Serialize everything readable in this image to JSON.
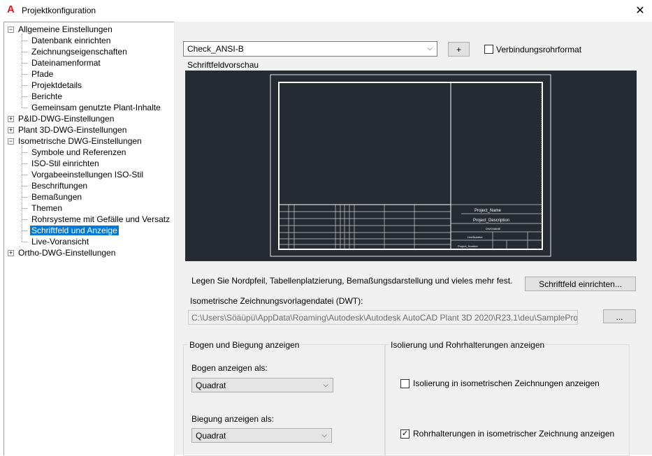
{
  "window": {
    "title": "Projektkonfiguration"
  },
  "tree": [
    {
      "label": "Allgemeine Einstellungen",
      "level": 0,
      "expander": "minus"
    },
    {
      "label": "Datenbank einrichten",
      "level": 1
    },
    {
      "label": "Zeichnungseigenschaften",
      "level": 1
    },
    {
      "label": "Dateinamenformat",
      "level": 1
    },
    {
      "label": "Pfade",
      "level": 1
    },
    {
      "label": "Projektdetails",
      "level": 1
    },
    {
      "label": "Berichte",
      "level": 1
    },
    {
      "label": "Gemeinsam genutzte Plant-Inhalte",
      "level": 1
    },
    {
      "label": "P&ID-DWG-Einstellungen",
      "level": 0,
      "expander": "plus"
    },
    {
      "label": "Plant 3D-DWG-Einstellungen",
      "level": 0,
      "expander": "plus"
    },
    {
      "label": "Isometrische DWG-Einstellungen",
      "level": 0,
      "expander": "minus"
    },
    {
      "label": "Symbole und Referenzen",
      "level": 1
    },
    {
      "label": "ISO-Stil einrichten",
      "level": 1
    },
    {
      "label": "Vorgabeeinstellungen ISO-Stil",
      "level": 1
    },
    {
      "label": "Beschriftungen",
      "level": 1
    },
    {
      "label": "Bemaßungen",
      "level": 1
    },
    {
      "label": "Themen",
      "level": 1
    },
    {
      "label": "Rohrsysteme mit Gefälle und Versatz",
      "level": 1
    },
    {
      "label": "Schriftfeld und Anzeige",
      "level": 1,
      "selected": true
    },
    {
      "label": "Live-Voransicht",
      "level": 1
    },
    {
      "label": "Ortho-DWG-Einstellungen",
      "level": 0,
      "expander": "plus"
    }
  ],
  "main": {
    "style_combo": "Check_ANSI-B",
    "add_button": "+",
    "verbindungsrohr_label": "Verbindungsrohrformat",
    "preview_title": "Schriftfeldvorschau",
    "preview_texts": {
      "project_name": "Project_Name",
      "project_description": "Project_Description",
      "dwgname": "DWGNAME",
      "project_number": "Project_Number",
      "linenumber": "LineNumber"
    },
    "description": "Legen Sie Nordpfeil, Tabellenplatzierung, Bemaßungsdarstellung und vieles mehr fest.",
    "setup_titleblock_button": "Schriftfeld einrichten...",
    "template_label": "Isometrische Zeichnungsvorlagendatei (DWT):",
    "template_path": "C:\\Users\\Söäüpü\\AppData\\Roaming\\Autodesk\\Autodesk AutoCAD Plant 3D 2020\\R23.1\\deu\\SampleProjects\\Sar",
    "browse_button": "...",
    "bends_group": {
      "title": "Bogen und Biegung anzeigen",
      "bogen_label": "Bogen anzeigen als:",
      "bogen_value": "Quadrat",
      "biegung_label": "Biegung anzeigen als:",
      "biegung_value": "Quadrat"
    },
    "insulation_group": {
      "title": "Isolierung und Rohrhalterungen anzeigen",
      "insulation_label": "Isolierung in isometrischen Zeichnungen anzeigen",
      "insulation_checked": false,
      "supports_label": "Rohrhalterungen in isometrischer Zeichnung anzeigen",
      "supports_checked": true
    }
  },
  "colors": {
    "selection": "#0078d7",
    "preview_bg": "#262a33",
    "app_icon": "#d71920"
  }
}
